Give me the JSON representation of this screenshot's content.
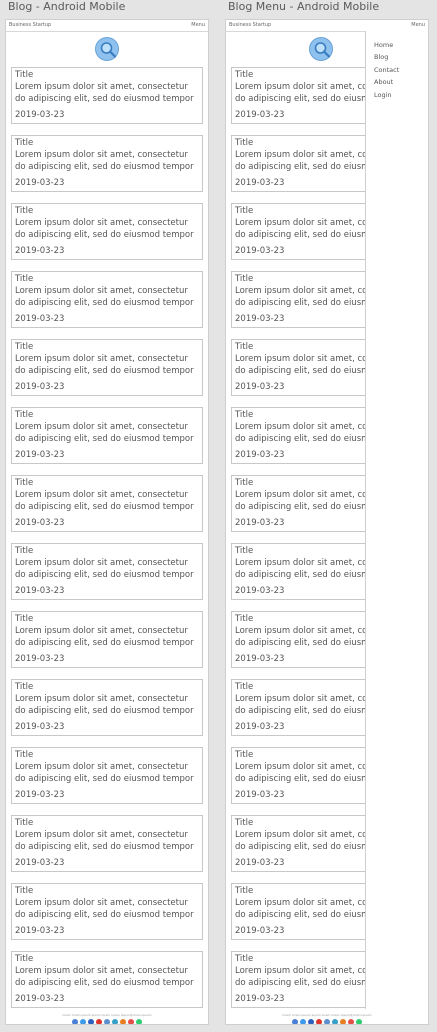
{
  "left": {
    "board_title": "Blog - Android Mobile",
    "brand": "Business Startup",
    "menu_label": "Menu"
  },
  "right": {
    "board_title": "Blog Menu  - Android Mobile",
    "brand": "Business Startup",
    "menu_label": "Menu",
    "menu_items": [
      "Home",
      "Blog",
      "Contact",
      "About",
      "Login"
    ]
  },
  "card": {
    "title": "Title",
    "body": "Lorem ipsum dolor sit amet, consectetur do adipiscing elit, sed do eiusmod tempor",
    "date": "2019-03-23"
  },
  "card_count": 14,
  "footer_text": "lorem lorem ipsum ipsum lorem lorem ipsum@lorem.ipsum",
  "social_colors": [
    "#4a7fd6",
    "#3d9be9",
    "#2d5fbf",
    "#e0332c",
    "#5c8fd0",
    "#36a0c9",
    "#e67e22",
    "#e14f48",
    "#2ecc71"
  ]
}
